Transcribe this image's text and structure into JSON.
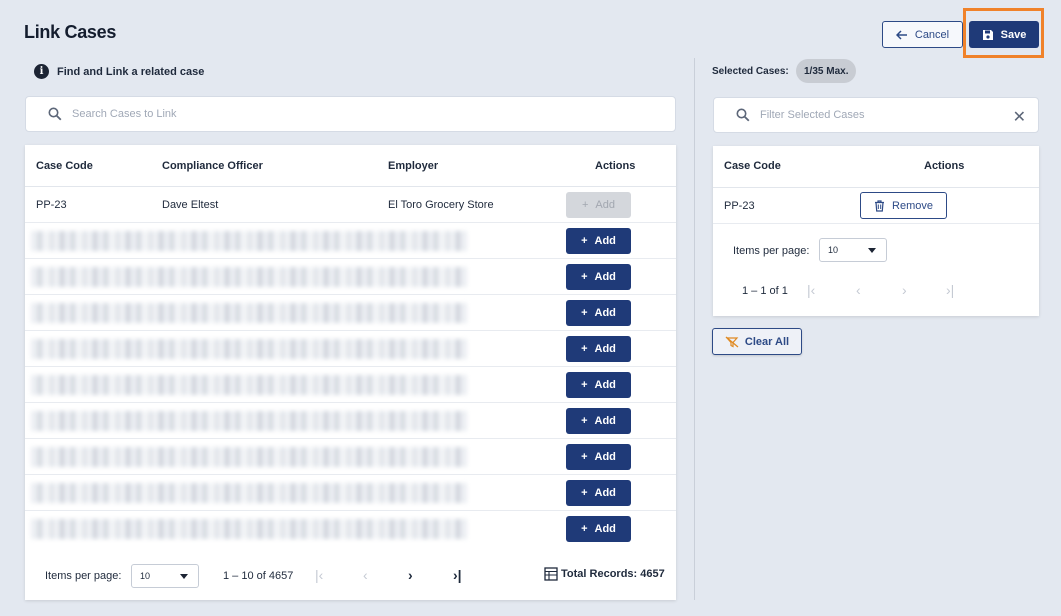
{
  "header": {
    "title": "Link Cases",
    "cancel_label": "Cancel",
    "save_label": "Save"
  },
  "left": {
    "info_text": "Find and Link a related case",
    "search_placeholder": "Search Cases to Link",
    "columns": [
      "Case Code",
      "Compliance Officer",
      "Employer",
      "Actions"
    ],
    "first_row": {
      "case_code": "PP-23",
      "officer": "Dave Eltest",
      "employer": "El Toro Grocery Store",
      "action": "Add",
      "action_disabled": true
    },
    "add_label": "Add",
    "blurred_row_count": 9,
    "pager": {
      "items_per_page_label": "Items per page:",
      "items_per_page_value": "10",
      "range": "1 – 10 of 4657",
      "total_records": "Total Records: 4657"
    }
  },
  "right": {
    "selected_label": "Selected Cases:",
    "selected_badge": "1/35 Max.",
    "filter_placeholder": "Filter Selected Cases",
    "columns": [
      "Case Code",
      "Actions"
    ],
    "rows": [
      {
        "case_code": "PP-23",
        "action": "Remove"
      }
    ],
    "pager": {
      "items_per_page_label": "Items per page:",
      "items_per_page_value": "10",
      "range": "1 – 1 of 1"
    },
    "clear_all_label": "Clear All"
  },
  "colors": {
    "primary": "#1f3a78",
    "highlight": "#f0822a",
    "background": "#e3e8f0"
  }
}
